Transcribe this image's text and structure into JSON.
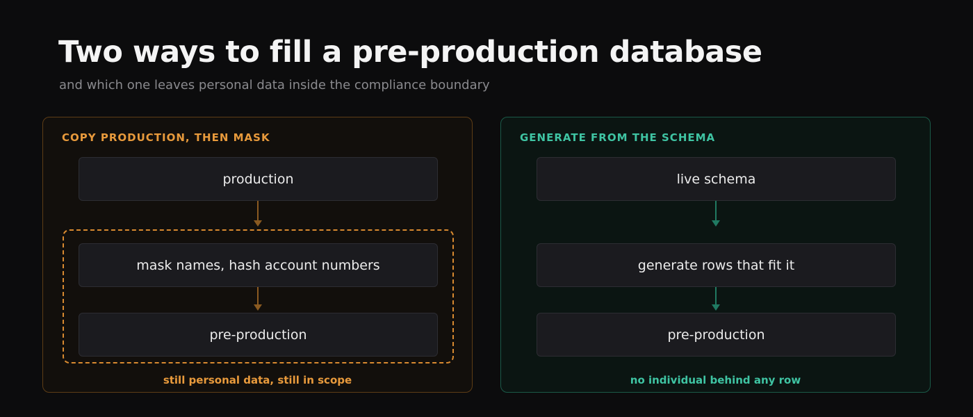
{
  "title": "Two ways to fill a pre-production database",
  "subtitle": "and which one leaves personal data inside the compliance boundary",
  "colors": {
    "left_accent": "#e89a3c",
    "right_accent": "#3fc4a3",
    "background": "#0c0c0d",
    "node_fill": "#1b1b1f"
  },
  "panels": [
    {
      "label": "COPY PRODUCTION, THEN MASK",
      "steps": [
        "production",
        "mask names, hash account numbers",
        "pre-production"
      ],
      "note": "still personal data, still in scope"
    },
    {
      "label": "GENERATE FROM THE SCHEMA",
      "steps": [
        "live schema",
        "generate rows that fit it",
        "pre-production"
      ],
      "note": "no individual behind any row"
    }
  ]
}
